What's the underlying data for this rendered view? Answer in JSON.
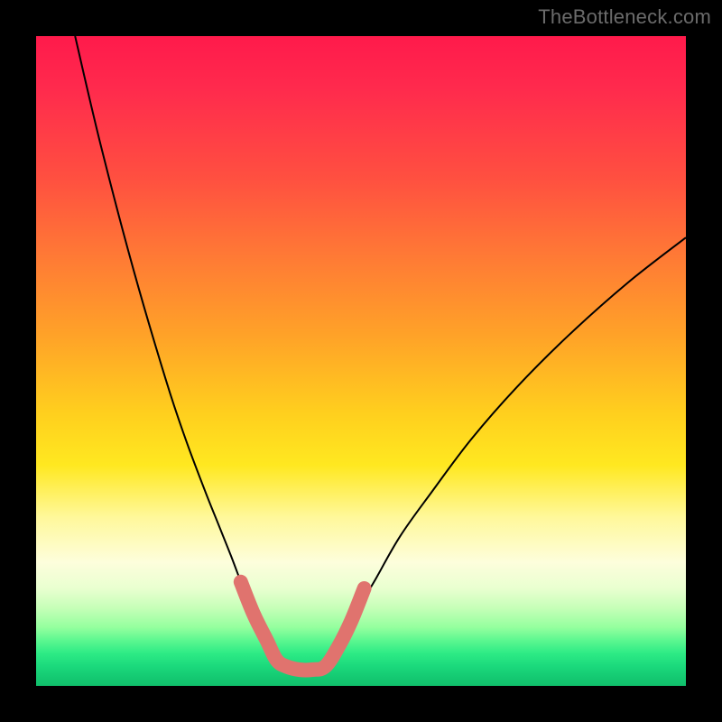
{
  "watermark": "TheBottleneck.com",
  "colors": {
    "background": "#000000",
    "curve": "#000000",
    "annotation": "#e0736e",
    "gradient_top": "#ff1a4b",
    "gradient_bottom": "#10bf6b"
  },
  "chart_data": {
    "type": "line",
    "title": "",
    "xlabel": "",
    "ylabel": "",
    "xlim": [
      0,
      100
    ],
    "ylim": [
      0,
      100
    ],
    "grid": false,
    "legend": false,
    "note": "No axis ticks or numeric labels are shown; x/y values are estimated in 0–100 screen-space units (0,0 = top-left of gradient panel).",
    "series": [
      {
        "name": "left-curve",
        "x": [
          6,
          10,
          15,
          20,
          23,
          26,
          28,
          30,
          31.5,
          33,
          34.5,
          36,
          37.5
        ],
        "y": [
          0,
          17,
          36,
          53,
          62,
          70,
          75,
          80,
          84,
          88,
          91,
          94,
          97
        ]
      },
      {
        "name": "right-curve",
        "x": [
          45,
          47,
          49,
          52,
          56,
          61,
          67,
          74,
          82,
          91,
          100
        ],
        "y": [
          97,
          93,
          89,
          84,
          77,
          70,
          62,
          54,
          46,
          38,
          31
        ]
      },
      {
        "name": "highlight-annotation",
        "x": [
          31.5,
          33.5,
          35.5,
          37,
          38.5,
          40.5,
          42.5,
          44.5,
          46.5,
          48.5,
          50.5
        ],
        "y": [
          84,
          89,
          93,
          96,
          97,
          97.5,
          97.5,
          97,
          94,
          90,
          85
        ]
      }
    ]
  }
}
